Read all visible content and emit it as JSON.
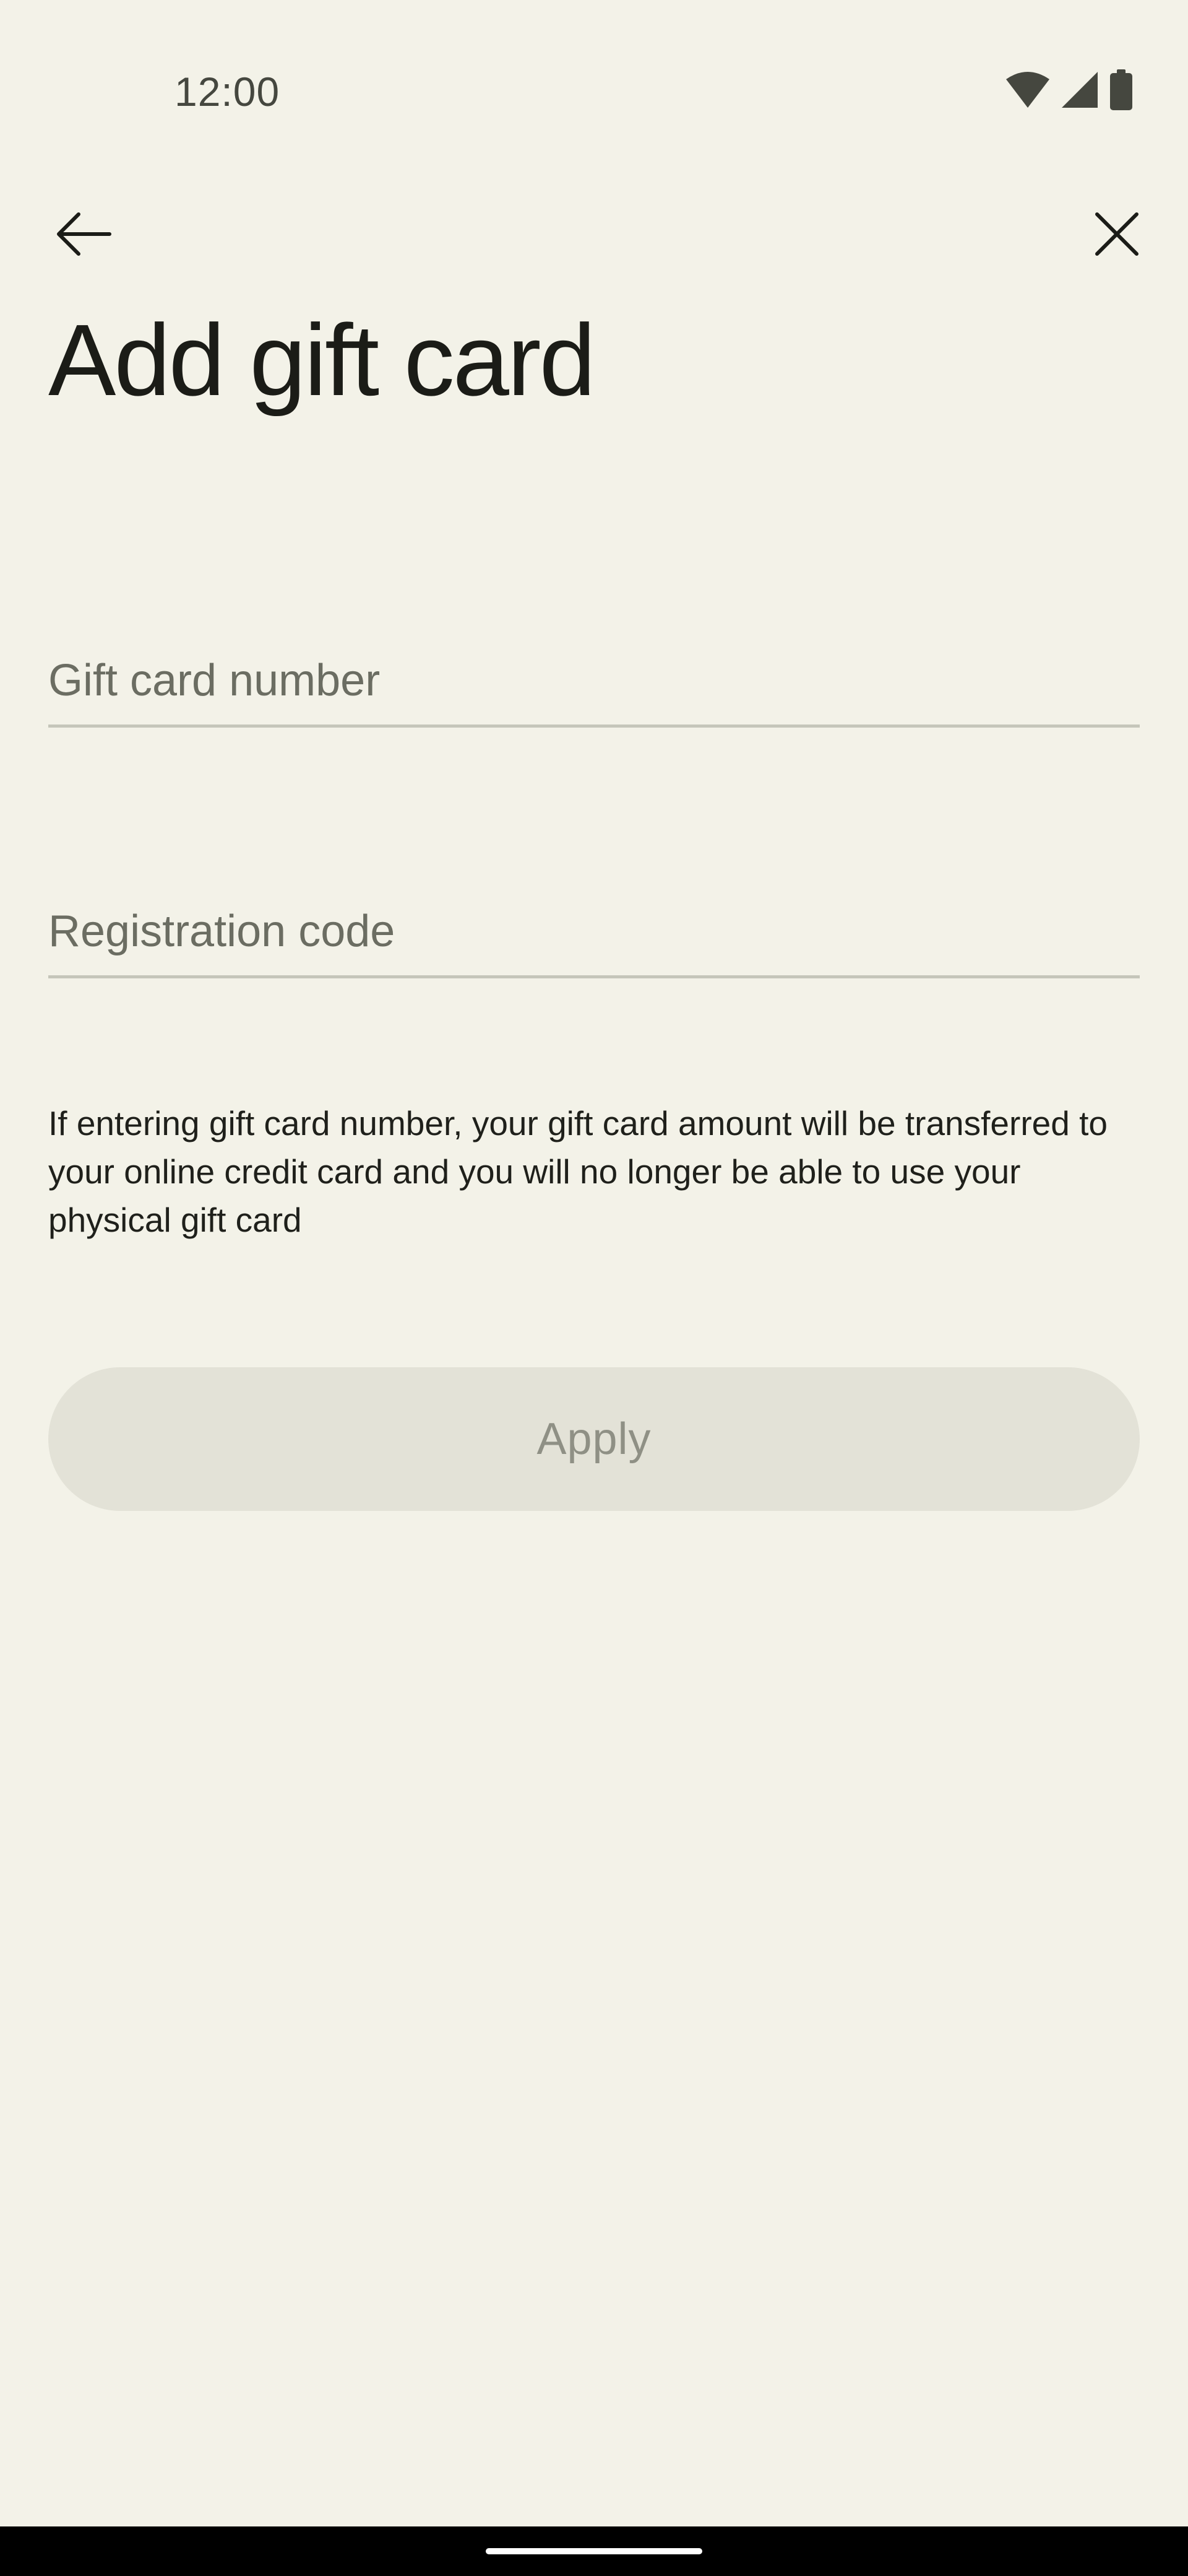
{
  "status_bar": {
    "time": "12:00",
    "icons": [
      "wifi-icon",
      "cellular-signal-icon",
      "battery-icon"
    ]
  },
  "top_bar": {
    "back_icon": "arrow-left-icon",
    "close_icon": "close-icon"
  },
  "page": {
    "title": "Add gift card"
  },
  "form": {
    "gift_card_number": {
      "placeholder": "Gift card number",
      "value": ""
    },
    "registration_code": {
      "placeholder": "Registration code",
      "value": ""
    },
    "info_text": "If entering gift card number, your gift card amount will be transferred to your online credit card and you will no longer be able to use your physical gift card",
    "apply_label": "Apply"
  },
  "colors": {
    "background": "#f3f2e8",
    "button_disabled_bg": "#e3e2d7",
    "button_disabled_text": "#8f9085",
    "field_underline": "#c5c6ba"
  }
}
